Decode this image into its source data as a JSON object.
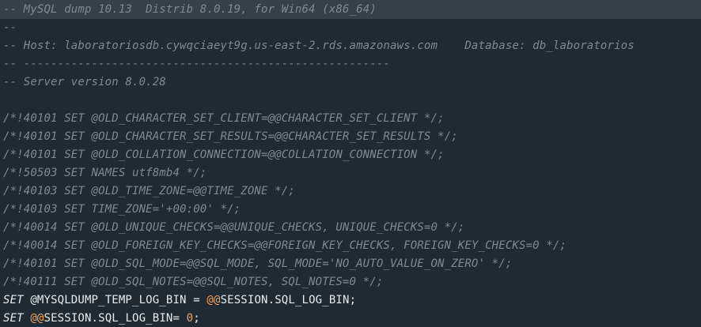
{
  "editor": {
    "lines": [
      "-- MySQL dump 10.13  Distrib 8.0.19, for Win64 (x86_64)",
      "--",
      "-- Host: laboratoriosdb.cywqciaeyt9g.us-east-2.rds.amazonaws.com    Database: db_laboratorios",
      "-- ------------------------------------------------------",
      "-- Server version 8.0.28",
      "",
      "/*!40101 SET @OLD_CHARACTER_SET_CLIENT=@@CHARACTER_SET_CLIENT */;",
      "/*!40101 SET @OLD_CHARACTER_SET_RESULTS=@@CHARACTER_SET_RESULTS */;",
      "/*!40101 SET @OLD_COLLATION_CONNECTION=@@COLLATION_CONNECTION */;",
      "/*!50503 SET NAMES utf8mb4 */;",
      "/*!40103 SET @OLD_TIME_ZONE=@@TIME_ZONE */;",
      "/*!40103 SET TIME_ZONE='+00:00' */;",
      "/*!40014 SET @OLD_UNIQUE_CHECKS=@@UNIQUE_CHECKS, UNIQUE_CHECKS=0 */;",
      "/*!40014 SET @OLD_FOREIGN_KEY_CHECKS=@@FOREIGN_KEY_CHECKS, FOREIGN_KEY_CHECKS=0 */;",
      "/*!40101 SET @OLD_SQL_MODE=@@SQL_MODE, SQL_MODE='NO_AUTO_VALUE_ON_ZERO' */;",
      "/*!40111 SET @OLD_SQL_NOTES=@@SQL_NOTES, SQL_NOTES=0 */;"
    ],
    "stmt1": {
      "kw": "SET",
      "var": " @MYSQLDUMP_TEMP_LOG_BIN = ",
      "sys": "@@",
      "target": "SESSION.SQL_LOG_BIN",
      "end": ";"
    },
    "stmt2": {
      "kw": "SET",
      "sys": " @@",
      "target": "SESSION.SQL_LOG_BIN= ",
      "num": "0",
      "end": ";"
    },
    "colors": {
      "background": "#1f2a33",
      "current_line": "#34414a",
      "comment": "#7d8a95",
      "text": "#e6edf2",
      "system_variable": "#f2a45a"
    }
  }
}
